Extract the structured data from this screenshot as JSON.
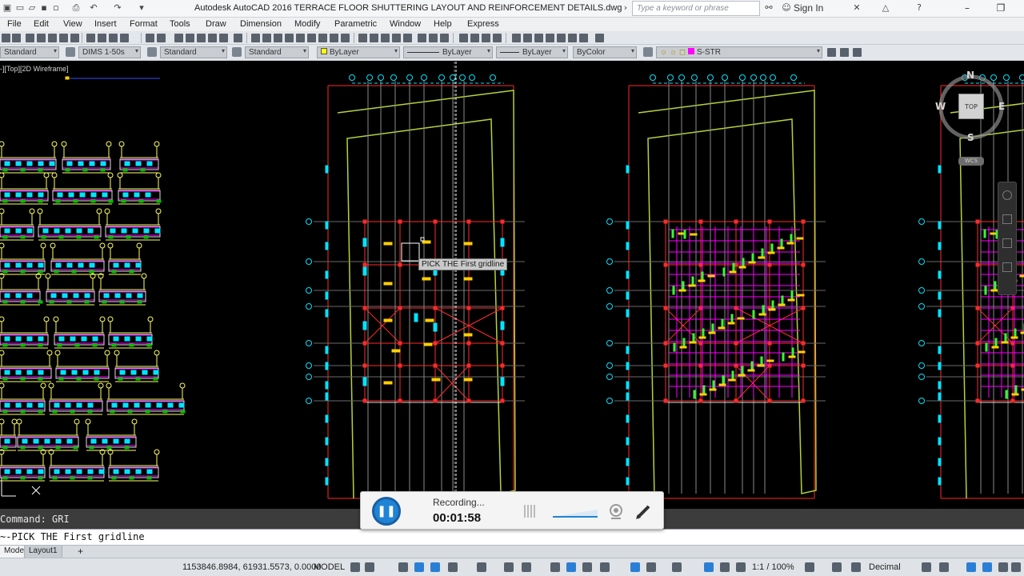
{
  "window": {
    "title": "Autodesk AutoCAD 2016    TERRACE FLOOR SHUTTERING LAYOUT AND REINFORCEMENT DETAILS.dwg",
    "search_placeholder": "Type a keyword or phrase",
    "signin_label": "Sign In"
  },
  "menu": {
    "items": [
      "File",
      "Edit",
      "View",
      "Insert",
      "Format",
      "Tools",
      "Draw",
      "Dimension",
      "Modify",
      "Parametric",
      "Window",
      "Help",
      "Express"
    ]
  },
  "toolbar": {
    "text_style": "Standard",
    "dim_style": "DIMS 1-50s",
    "table_style": "Standard",
    "mleader_style": "Standard",
    "color": "ByLayer",
    "linetype": "ByLayer",
    "lineweight": "ByLayer",
    "plotstyle": "ByColor",
    "layer": "S-STR"
  },
  "viewport": {
    "label": "-][Top][2D Wireframe]",
    "tooltip": "PICK THE First gridline"
  },
  "viewcube": {
    "north": "N",
    "south": "S",
    "east": "E",
    "west": "W",
    "face": "TOP",
    "wcs": "WCS"
  },
  "command": {
    "history": "Command: GRI",
    "prompt": "~-PICK THE First gridline"
  },
  "tabs": {
    "model": "Model",
    "layout1": "Layout1",
    "add": "+"
  },
  "status": {
    "coords": "1153846.8984, 61931.5573, 0.0000",
    "space": "MODEL",
    "scale": "1:1 / 100%",
    "units": "Decimal"
  },
  "recorder": {
    "status": "Recording...",
    "time": "00:01:58"
  },
  "colors": {
    "cad_background": "#000000",
    "grid_line": "#d9d9d9",
    "outline_green": "#b5d33a",
    "beam_red": "#ff2a2a",
    "rebar_magenta": "#ff00ff",
    "column_cyan": "#00e5ff",
    "slab_yellow": "#ffd000",
    "dim_yellow": "#ffff66",
    "rebar_green": "#33ff33"
  },
  "icons": {
    "quick_access": [
      "new-file-icon",
      "open-icon",
      "save-icon",
      "save-as-icon",
      "print-icon",
      "undo-icon",
      "redo-icon"
    ],
    "status_bar": [
      "grid-icon",
      "snap-icon",
      "ortho-icon",
      "polar-icon",
      "osnap-icon",
      "annotation-icon",
      "workspace-icon",
      "fullscreen-icon"
    ]
  }
}
